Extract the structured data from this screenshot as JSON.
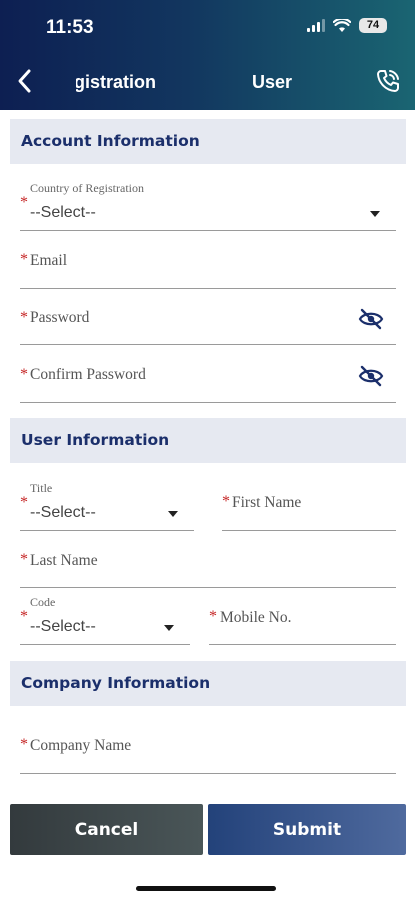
{
  "status_bar": {
    "time": "11:53",
    "battery": "74"
  },
  "nav": {
    "left_tab": "Registration",
    "title": "User"
  },
  "sections": {
    "account": "Account Information",
    "user": "User Information",
    "company": "Company Information"
  },
  "fields": {
    "country": {
      "label": "Country of Registration",
      "value": "--Select--"
    },
    "email": {
      "placeholder": "Email"
    },
    "password": {
      "placeholder": "Password"
    },
    "confirm_password": {
      "placeholder": "Confirm Password"
    },
    "title": {
      "label": "Title",
      "value": "--Select--"
    },
    "first_name": {
      "placeholder": "First Name"
    },
    "last_name": {
      "placeholder": "Last Name"
    },
    "code": {
      "label": "Code",
      "value": "--Select--"
    },
    "mobile": {
      "placeholder": "Mobile No."
    },
    "company_name": {
      "placeholder": "Company Name"
    }
  },
  "required_mark": "*",
  "buttons": {
    "cancel": "Cancel",
    "submit": "Submit"
  },
  "colors": {
    "section_text": "#1b2f6b",
    "required": "#c62828",
    "header_start": "#0d1f52",
    "header_end": "#1a6572"
  }
}
